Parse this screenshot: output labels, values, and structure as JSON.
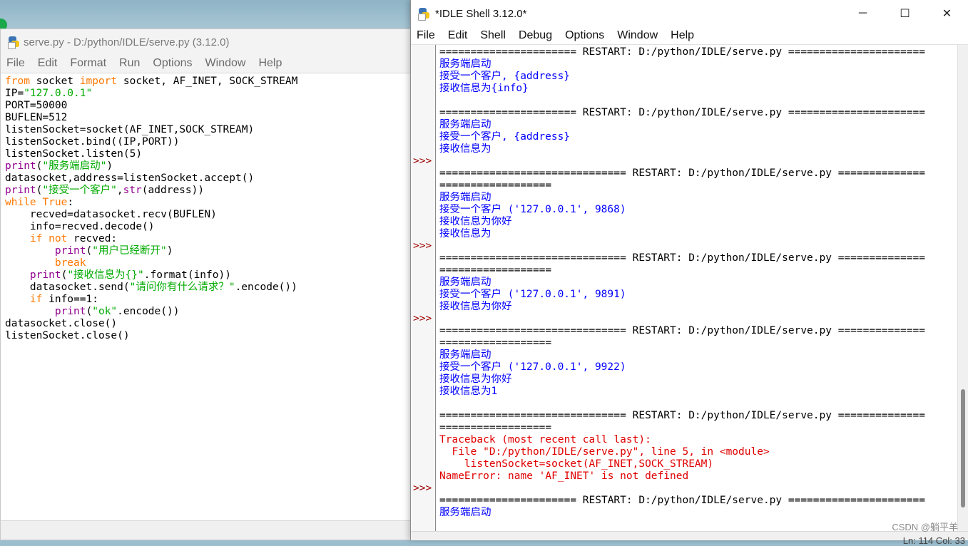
{
  "editor": {
    "title": "serve.py - D:/python/IDLE/serve.py (3.12.0)",
    "menu": [
      "File",
      "Edit",
      "Format",
      "Run",
      "Options",
      "Window",
      "Help"
    ],
    "code": [
      [
        {
          "t": "from",
          "c": "kw"
        },
        {
          "t": " socket "
        },
        {
          "t": "import",
          "c": "kw"
        },
        {
          "t": " socket, AF_INET, SOCK_STREAM"
        }
      ],
      [
        {
          "t": "IP="
        },
        {
          "t": "\"127.0.0.1\"",
          "c": "st"
        }
      ],
      [
        {
          "t": "PORT=50000"
        }
      ],
      [
        {
          "t": "BUFLEN=512"
        }
      ],
      [
        {
          "t": "listenSocket=socket(AF_INET,SOCK_STREAM)"
        }
      ],
      [
        {
          "t": "listenSocket.bind((IP,PORT))"
        }
      ],
      [
        {
          "t": "listenSocket.listen(5)"
        }
      ],
      [
        {
          "t": "print",
          "c": "bi"
        },
        {
          "t": "("
        },
        {
          "t": "\"服务端启动\"",
          "c": "st"
        },
        {
          "t": ")"
        }
      ],
      [
        {
          "t": "datasocket,address=listenSocket.accept()"
        }
      ],
      [
        {
          "t": "print",
          "c": "bi"
        },
        {
          "t": "("
        },
        {
          "t": "\"接受一个客户\"",
          "c": "st"
        },
        {
          "t": ","
        },
        {
          "t": "str",
          "c": "bi"
        },
        {
          "t": "(address))"
        }
      ],
      [
        {
          "t": "while",
          "c": "kw"
        },
        {
          "t": " "
        },
        {
          "t": "True",
          "c": "kw"
        },
        {
          "t": ":"
        }
      ],
      [
        {
          "t": "    recved=datasocket.recv(BUFLEN)"
        }
      ],
      [
        {
          "t": "    info=recved.decode()"
        }
      ],
      [
        {
          "t": "    "
        },
        {
          "t": "if",
          "c": "kw"
        },
        {
          "t": " "
        },
        {
          "t": "not",
          "c": "kw"
        },
        {
          "t": " recved:"
        }
      ],
      [
        {
          "t": "        "
        },
        {
          "t": "print",
          "c": "bi"
        },
        {
          "t": "("
        },
        {
          "t": "\"用户已经断开\"",
          "c": "st"
        },
        {
          "t": ")"
        }
      ],
      [
        {
          "t": "        "
        },
        {
          "t": "break",
          "c": "kw"
        }
      ],
      [
        {
          "t": "    "
        },
        {
          "t": "print",
          "c": "bi"
        },
        {
          "t": "("
        },
        {
          "t": "\"接收信息为{}\"",
          "c": "st"
        },
        {
          "t": ".format(info))"
        }
      ],
      [
        {
          "t": "    datasocket.send("
        },
        {
          "t": "\"请问你有什么请求？\"",
          "c": "st"
        },
        {
          "t": ".encode())"
        }
      ],
      [
        {
          "t": "    "
        },
        {
          "t": "if",
          "c": "kw"
        },
        {
          "t": " info==1:"
        }
      ],
      [
        {
          "t": "        "
        },
        {
          "t": "print",
          "c": "bi"
        },
        {
          "t": "("
        },
        {
          "t": "\"ok\"",
          "c": "st"
        },
        {
          "t": ".encode())"
        }
      ],
      [
        {
          "t": "datasocket.close()"
        }
      ],
      [
        {
          "t": "listenSocket.close()"
        }
      ]
    ]
  },
  "shell": {
    "title": "*IDLE Shell 3.12.0*",
    "menu": [
      "File",
      "Edit",
      "Shell",
      "Debug",
      "Options",
      "Window",
      "Help"
    ],
    "window_buttons": {
      "minimize": "─",
      "maximize": "☐",
      "close": "✕"
    },
    "prompt": ">>>",
    "lines": [
      {
        "t": "====================== RESTART: D:/python/IDLE/serve.py ======================",
        "c": "restart"
      },
      {
        "t": "服务端启动",
        "c": "out"
      },
      {
        "t": "接受一个客户, {address}",
        "c": "out"
      },
      {
        "t": "接收信息为{info}",
        "c": "out"
      },
      {
        "t": "",
        "c": "out"
      },
      {
        "t": "====================== RESTART: D:/python/IDLE/serve.py ======================",
        "c": "restart"
      },
      {
        "t": "服务端启动",
        "c": "out"
      },
      {
        "t": "接受一个客户, {address}",
        "c": "out"
      },
      {
        "t": "接收信息为",
        "c": "out"
      },
      {
        "t": "",
        "c": "out",
        "p": true
      },
      {
        "t": "============================== RESTART: D:/python/IDLE/serve.py ==============",
        "c": "restart"
      },
      {
        "t": "==================",
        "c": "restart"
      },
      {
        "t": "服务端启动",
        "c": "out"
      },
      {
        "t": "接受一个客户 ('127.0.0.1', 9868)",
        "c": "out"
      },
      {
        "t": "接收信息为你好",
        "c": "out"
      },
      {
        "t": "接收信息为",
        "c": "out"
      },
      {
        "t": "",
        "c": "out",
        "p": true
      },
      {
        "t": "============================== RESTART: D:/python/IDLE/serve.py ==============",
        "c": "restart"
      },
      {
        "t": "==================",
        "c": "restart"
      },
      {
        "t": "服务端启动",
        "c": "out"
      },
      {
        "t": "接受一个客户 ('127.0.0.1', 9891)",
        "c": "out"
      },
      {
        "t": "接收信息为你好",
        "c": "out"
      },
      {
        "t": "",
        "c": "out",
        "p": true
      },
      {
        "t": "============================== RESTART: D:/python/IDLE/serve.py ==============",
        "c": "restart"
      },
      {
        "t": "==================",
        "c": "restart"
      },
      {
        "t": "服务端启动",
        "c": "out"
      },
      {
        "t": "接受一个客户 ('127.0.0.1', 9922)",
        "c": "out"
      },
      {
        "t": "接收信息为你好",
        "c": "out"
      },
      {
        "t": "接收信息为1",
        "c": "out"
      },
      {
        "t": "",
        "c": "out"
      },
      {
        "t": "============================== RESTART: D:/python/IDLE/serve.py ==============",
        "c": "restart"
      },
      {
        "t": "==================",
        "c": "restart"
      },
      {
        "t": "Traceback (most recent call last):",
        "c": "err"
      },
      {
        "t": "  File \"D:/python/IDLE/serve.py\", line 5, in <module>",
        "c": "err"
      },
      {
        "t": "    listenSocket=socket(AF_INET,SOCK_STREAM)",
        "c": "err"
      },
      {
        "t": "NameError: name 'AF_INET' is not defined",
        "c": "err"
      },
      {
        "t": "",
        "c": "out",
        "p": true
      },
      {
        "t": "====================== RESTART: D:/python/IDLE/serve.py ======================",
        "c": "restart"
      },
      {
        "t": "服务端启动",
        "c": "out"
      }
    ],
    "status": "Ln: 114  Col: 33"
  },
  "watermark": "CSDN @躺平羊",
  "colors": {
    "keyword": "#ff7700",
    "string": "#00aa00",
    "builtin": "#900090",
    "stdout": "#0000ff",
    "stderr": "#e00000",
    "prompt": "#a00000"
  }
}
